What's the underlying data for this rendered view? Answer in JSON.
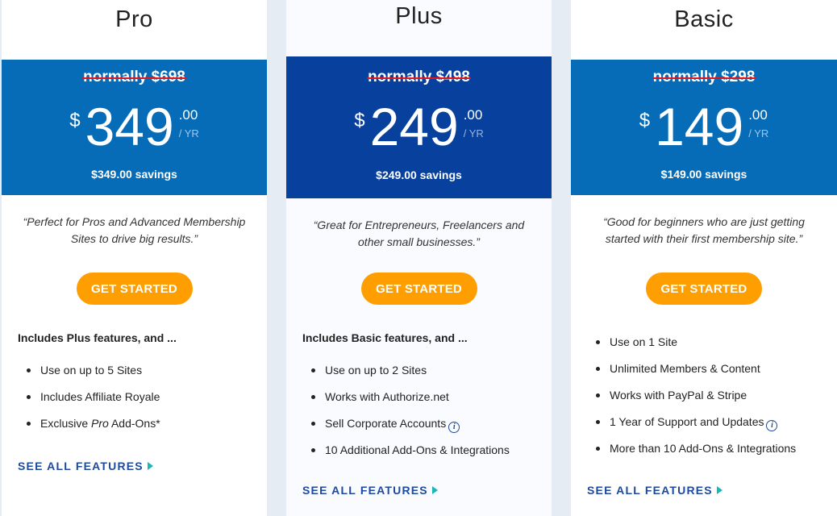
{
  "colors": {
    "pro_panel": "#066cb8",
    "plus_panel": "#07419d",
    "basic_panel": "#066cb8",
    "cta": "#fe9e00",
    "strike": "#e3141b",
    "link": "#1d4aa0",
    "link_arrow": "#1ab6b9"
  },
  "plans": [
    {
      "name": "Pro",
      "normally": "normally $698",
      "currency": "$",
      "amount": "349",
      "cents": ".00",
      "period": "/ YR",
      "savings": "$349.00 savings",
      "tagline": "“Perfect for Pros and Advanced Membership Sites to drive big results.”",
      "cta": "GET STARTED",
      "includes": "Includes Plus features, and ...",
      "features": [
        {
          "text": "Use on up to 5 Sites"
        },
        {
          "text": "Includes Affiliate Royale"
        },
        {
          "pre": "Exclusive ",
          "em": "Pro",
          "post": " Add-Ons*"
        }
      ],
      "see_all": "SEE ALL FEATURES",
      "link_icon": "play-arrow-icon"
    },
    {
      "name": "Plus",
      "normally": "normally $498",
      "currency": "$",
      "amount": "249",
      "cents": ".00",
      "period": "/ YR",
      "savings": "$249.00 savings",
      "tagline": "“Great for Entrepreneurs, Freelancers and other small businesses.”",
      "cta": "GET STARTED",
      "includes": "Includes Basic features, and ...",
      "features": [
        {
          "text": "Use on up to 2 Sites"
        },
        {
          "text": "Works with Authorize.net"
        },
        {
          "text": "Sell Corporate Accounts",
          "info": "i"
        },
        {
          "text": "10 Additional Add-Ons & Integrations"
        }
      ],
      "see_all": "SEE ALL FEATURES",
      "link_icon": "play-arrow-icon"
    },
    {
      "name": "Basic",
      "normally": "normally $298",
      "currency": "$",
      "amount": "149",
      "cents": ".00",
      "period": "/ YR",
      "savings": "$149.00 savings",
      "tagline": "“Good for beginners who are just getting started with their first membership site.”",
      "cta": "GET STARTED",
      "features": [
        {
          "text": "Use on 1 Site"
        },
        {
          "text": "Unlimited Members & Content"
        },
        {
          "text": "Works with PayPal & Stripe"
        },
        {
          "text": "1 Year of Support and Updates",
          "info": "i"
        },
        {
          "text": "More than 10 Add-Ons & Integrations"
        }
      ],
      "see_all": "SEE ALL FEATURES",
      "link_icon": "play-arrow-icon"
    }
  ]
}
